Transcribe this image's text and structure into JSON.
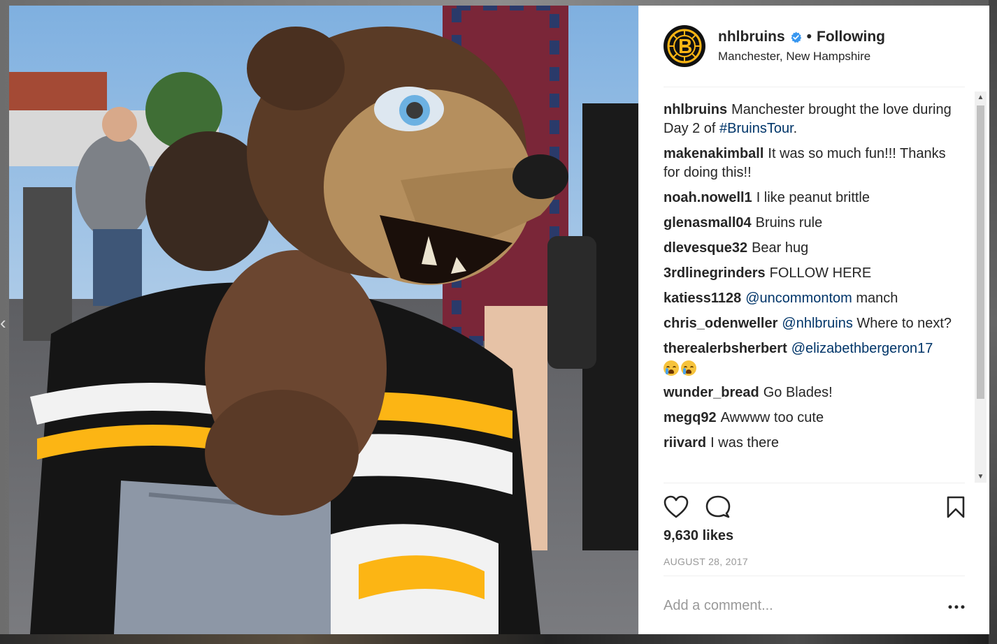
{
  "post": {
    "username": "nhlbruins",
    "separator": "•",
    "follow_status": "Following",
    "location": "Manchester, New Hampshire",
    "likes": "9,630 likes",
    "date": "AUGUST 28, 2017",
    "add_comment_placeholder": "Add a comment...",
    "photo_alt": "Boston Bruins mascot hugging a child"
  },
  "comments": [
    {
      "user": "nhlbruins",
      "text": "Manchester brought the love during Day 2 of ",
      "link": "#BruinsTour",
      "after": "."
    },
    {
      "user": "makenakimball",
      "text": "It was so much fun!!! Thanks for doing this!!"
    },
    {
      "user": "noah.nowell1",
      "text": "I like peanut brittle"
    },
    {
      "user": "glenasmall04",
      "text": "Bruins rule"
    },
    {
      "user": "dlevesque32",
      "text": "Bear hug"
    },
    {
      "user": "3rdlinegrinders",
      "text": "FOLLOW HERE"
    },
    {
      "user": "katiess1128",
      "link": "@uncommontom",
      "text_after": " manch"
    },
    {
      "user": "chris_odenweller",
      "link": "@nhlbruins",
      "text_after": " Where to next?"
    },
    {
      "user": "therealerbsherbert",
      "link": "@elizabethbergeron17",
      "emoji_count": 2
    },
    {
      "user": "wunder_bread",
      "text": "Go Blades!"
    },
    {
      "user": "megq92",
      "text": "Awwww too cute"
    },
    {
      "user": "riivard",
      "text": "I was there"
    }
  ],
  "icons": {
    "verified": "verified-badge-icon",
    "like": "heart-icon",
    "comment": "comment-bubble-icon",
    "save": "bookmark-icon",
    "more": "more-options-icon"
  },
  "colors": {
    "link": "#003569",
    "verified": "#3897f0",
    "bruins_gold": "#fcb514"
  }
}
